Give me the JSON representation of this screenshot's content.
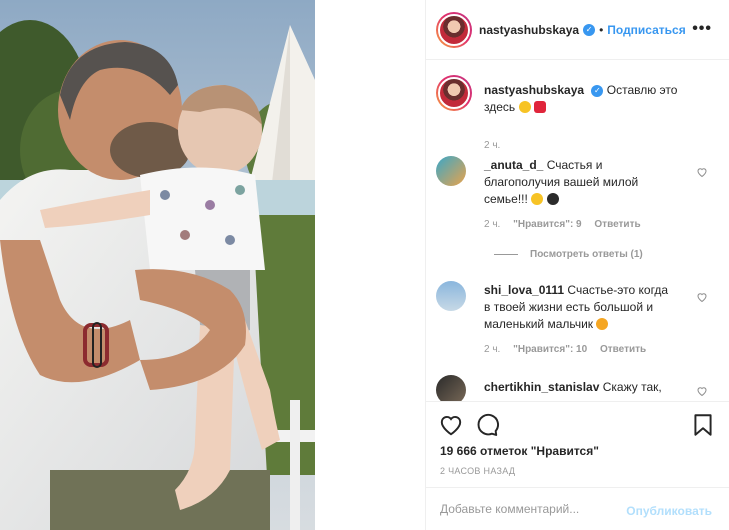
{
  "colors": {
    "accent": "#3897f0",
    "muted": "#999999",
    "text": "#262626",
    "border": "#efefef",
    "publish_disabled": "#b2dffc"
  },
  "photo": {
    "icon": "photo"
  },
  "header": {
    "username": "nastyashubskaya",
    "verified_icon": "verified-badge-icon",
    "separator": "•",
    "follow_label": "Подписаться",
    "more_icon": "more-options-icon",
    "more_label": "•••"
  },
  "caption": {
    "username": "nastyashubskaya",
    "text_line1": "Оставлю это",
    "text_line2": "здесь",
    "emojis": [
      "heart-eyes-emoji",
      "red-heart-emoji"
    ],
    "time": "2 ч."
  },
  "comments": [
    {
      "username": "_anuta_d_",
      "text_line1": "Счастья и",
      "text_line2": "благополучия вашей милой",
      "text_line3": "семье!!!",
      "emojis": [
        "heart-eyes-emoji",
        "crown-emoji"
      ],
      "time": "2 ч.",
      "likes": "\"Нравится\": 9",
      "reply": "Ответить",
      "view_replies": "Посмотреть ответы (1)"
    },
    {
      "username": "shi_lova_0111",
      "text_line1": "Счастье-это когда",
      "text_line2": "в твоей жизни есть большой и",
      "text_line3": "маленький мальчик",
      "emojis": [
        "heart-eyes-cat-emoji"
      ],
      "time": "2 ч.",
      "likes": "\"Нравится\": 10",
      "reply": "Ответить"
    },
    {
      "username": "chertikhin_stanislav",
      "text_line1": "Скажу так,"
    }
  ],
  "actions": {
    "like_icon": "heart-outline-icon",
    "comment_icon": "comment-bubble-icon",
    "share_icon": "paper-plane-icon",
    "save_icon": "bookmark-icon",
    "likes_text": "19 666 отметок \"Нравится\"",
    "time_text": "2 ЧАСОВ НАЗАД"
  },
  "add_comment": {
    "placeholder": "Добавьте комментарий...",
    "publish_label": "Опубликовать"
  }
}
